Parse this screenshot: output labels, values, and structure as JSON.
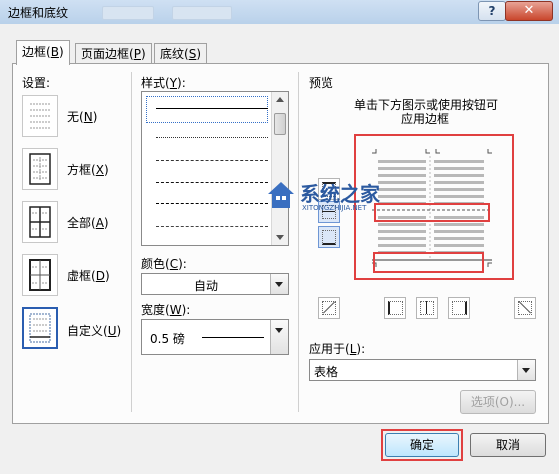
{
  "window": {
    "title": "边框和底纹",
    "help_label": "?",
    "close_label": "✕"
  },
  "tabs": [
    {
      "label": "边框",
      "hotkey": "B",
      "active": true
    },
    {
      "label": "页面边框",
      "hotkey": "P",
      "active": false
    },
    {
      "label": "底纹",
      "hotkey": "S",
      "active": false
    }
  ],
  "settings": {
    "heading": "设置:",
    "items": [
      {
        "label": "无",
        "hotkey": "N"
      },
      {
        "label": "方框",
        "hotkey": "X"
      },
      {
        "label": "全部",
        "hotkey": "A"
      },
      {
        "label": "虚框",
        "hotkey": "D"
      },
      {
        "label": "自定义",
        "hotkey": "U",
        "selected": true
      }
    ]
  },
  "style": {
    "heading": "样式",
    "hotkey": "Y",
    "line_styles": [
      "solid",
      "dotted-fine",
      "dashed-small",
      "dashed-medium",
      "dashed-large",
      "dash-dot"
    ]
  },
  "color": {
    "label": "颜色",
    "hotkey": "C",
    "value": "自动"
  },
  "width": {
    "label": "宽度",
    "hotkey": "W",
    "value": "0.5 磅"
  },
  "preview": {
    "heading": "预览",
    "hint_line1": "单击下方图示或使用按钮可",
    "hint_line2": "应用边框",
    "highlight_color": "#e04040"
  },
  "apply_to": {
    "label": "应用于",
    "hotkey": "L",
    "value": "表格"
  },
  "options_button": "选项(O)...",
  "ok_button": "确定",
  "cancel_button": "取消",
  "watermark": {
    "text": "系统之家",
    "subtext": "XITONGZHIJIA.NET"
  }
}
